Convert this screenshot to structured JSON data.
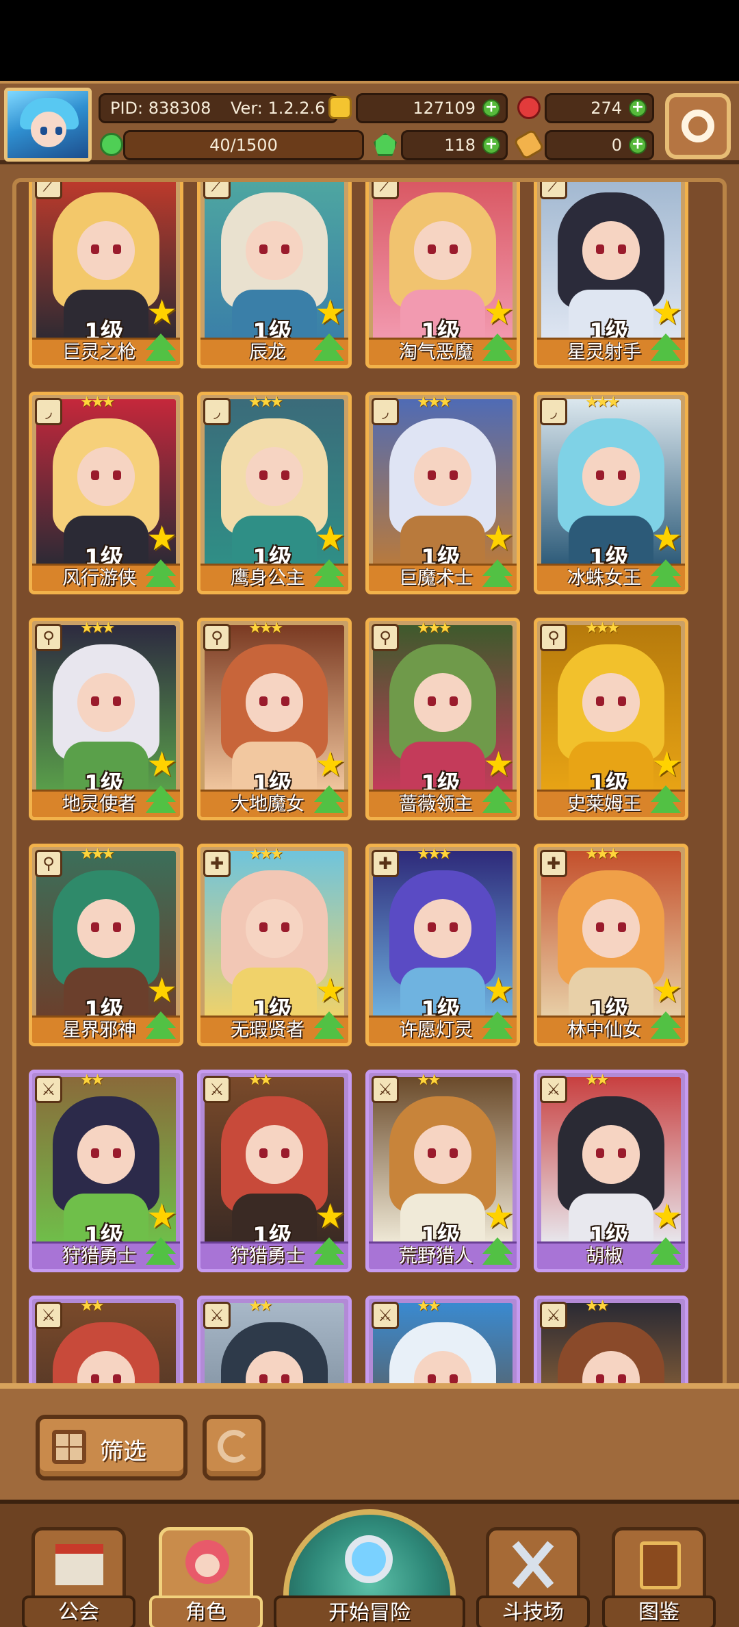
{
  "hud": {
    "pid": "PID: 838308",
    "version": "Ver: 1.2.2.6",
    "gold": "127109",
    "gems": "274",
    "stamina": "40/1500",
    "clover": "118",
    "keys": "0",
    "colors": {
      "gold": "#f4c430",
      "gem": "#e23b3b",
      "clover": "#4fcf55",
      "key": "#f2b24b"
    }
  },
  "roster": [
    {
      "name": "巨灵之枪",
      "level": "1级",
      "rarity": "★★★",
      "class_icon": "spear",
      "frame": "gold",
      "palette": [
        "#f3c86a",
        "#2d2a33",
        "#c43b2b"
      ]
    },
    {
      "name": "辰龙",
      "level": "1级",
      "rarity": "★★★",
      "class_icon": "spear",
      "frame": "gold",
      "palette": [
        "#e9e1cf",
        "#3a7fa8",
        "#4fa8a0"
      ]
    },
    {
      "name": "淘气恶魔",
      "level": "1级",
      "rarity": "★★★",
      "class_icon": "spear",
      "frame": "gold",
      "palette": [
        "#f1c36f",
        "#f29ab0",
        "#d8555f"
      ]
    },
    {
      "name": "星灵射手",
      "level": "1级",
      "rarity": "★★★",
      "class_icon": "spear",
      "frame": "gold",
      "palette": [
        "#2b2b3a",
        "#dfe6f2",
        "#9fb6cf"
      ]
    },
    {
      "name": "风行游侠",
      "level": "1级",
      "rarity": "★★★",
      "class_icon": "bow",
      "frame": "gold",
      "palette": [
        "#f6d07a",
        "#2b2a35",
        "#c5283b"
      ]
    },
    {
      "name": "鹰身公主",
      "level": "1级",
      "rarity": "★★★",
      "class_icon": "bow",
      "frame": "gold",
      "palette": [
        "#f2dcaa",
        "#2f8f86",
        "#3b6b7a"
      ]
    },
    {
      "name": "巨魔术士",
      "level": "1级",
      "rarity": "★★★",
      "class_icon": "bow",
      "frame": "gold",
      "palette": [
        "#dfe4f4",
        "#b97a3c",
        "#4f6bb5"
      ]
    },
    {
      "name": "冰蛛女王",
      "level": "1级",
      "rarity": "★★★",
      "class_icon": "bow",
      "frame": "gold",
      "palette": [
        "#7fd2e6",
        "#2c5a78",
        "#dbe7ee"
      ]
    },
    {
      "name": "地灵使者",
      "level": "1级",
      "rarity": "★★★",
      "class_icon": "staff",
      "frame": "gold",
      "palette": [
        "#e8e6ee",
        "#5aa04a",
        "#2d2a40"
      ]
    },
    {
      "name": "大地魔女",
      "level": "1级",
      "rarity": "★★★",
      "class_icon": "staff",
      "frame": "gold",
      "palette": [
        "#c8653a",
        "#f2c8a0",
        "#7a3a22"
      ]
    },
    {
      "name": "蔷薇领主",
      "level": "1级",
      "rarity": "★★★",
      "class_icon": "staff",
      "frame": "gold",
      "palette": [
        "#6f9a4a",
        "#c43b5a",
        "#3e5a2c"
      ]
    },
    {
      "name": "史莱姆王",
      "level": "1级",
      "rarity": "★★★",
      "class_icon": "staff",
      "frame": "gold",
      "palette": [
        "#f2c12c",
        "#e8a415",
        "#b67a0c"
      ]
    },
    {
      "name": "星界邪神",
      "level": "1级",
      "rarity": "★★★",
      "class_icon": "staff",
      "frame": "gold",
      "palette": [
        "#2f8a6a",
        "#6b3f2c",
        "#3b6f5a"
      ]
    },
    {
      "name": "无瑕贤者",
      "level": "1级",
      "rarity": "★★★",
      "class_icon": "cross",
      "frame": "gold",
      "palette": [
        "#f2c7b5",
        "#f0d26a",
        "#6fc4dc"
      ]
    },
    {
      "name": "许愿灯灵",
      "level": "1级",
      "rarity": "★★★",
      "class_icon": "cross",
      "frame": "gold",
      "palette": [
        "#5a4bc4",
        "#6fb3e0",
        "#2e2a7a"
      ]
    },
    {
      "name": "林中仙女",
      "level": "1级",
      "rarity": "★★★",
      "class_icon": "cross",
      "frame": "gold",
      "palette": [
        "#f0a048",
        "#e8d0a8",
        "#c4502c"
      ]
    },
    {
      "name": "狩猎勇士",
      "level": "1级",
      "rarity": "★★",
      "class_icon": "sword",
      "frame": "purple",
      "palette": [
        "#2c2a4a",
        "#6fbf4a",
        "#8a6a3a"
      ]
    },
    {
      "name": "狩猎勇士",
      "level": "1级",
      "rarity": "★★",
      "class_icon": "sword",
      "frame": "purple",
      "palette": [
        "#c84a3a",
        "#3a2a24",
        "#7a4a2a"
      ]
    },
    {
      "name": "荒野猎人",
      "level": "1级",
      "rarity": "★★",
      "class_icon": "sword",
      "frame": "purple",
      "palette": [
        "#c8843a",
        "#f0ead8",
        "#6a4a2a"
      ]
    },
    {
      "name": "胡椒",
      "level": "1级",
      "rarity": "★★",
      "class_icon": "sword",
      "frame": "purple",
      "palette": [
        "#2a2a34",
        "#e8e8ee",
        "#c84040"
      ]
    },
    {
      "name": "",
      "level": "",
      "rarity": "★★",
      "class_icon": "sword",
      "frame": "purple",
      "palette": [
        "#c84a3a",
        "#3a2a24",
        "#7a4a2a"
      ]
    },
    {
      "name": "",
      "level": "",
      "rarity": "★★",
      "class_icon": "sword",
      "frame": "purple",
      "palette": [
        "#2e3a4a",
        "#6a7a8a",
        "#a8b8c8"
      ]
    },
    {
      "name": "",
      "level": "",
      "rarity": "★★",
      "class_icon": "sword",
      "frame": "purple",
      "palette": [
        "#e8f0f8",
        "#6a4a2a",
        "#3a8ad0"
      ]
    },
    {
      "name": "",
      "level": "",
      "rarity": "★★",
      "class_icon": "sword",
      "frame": "purple",
      "palette": [
        "#8a4a2a",
        "#c8843a",
        "#2a2a34"
      ]
    }
  ],
  "controls": {
    "filter_label": "筛选"
  },
  "nav": {
    "guild": "公会",
    "heroes": "角色",
    "adventure": "开始冒险",
    "arena": "斗技场",
    "codex": "图鉴",
    "active": "heroes"
  }
}
